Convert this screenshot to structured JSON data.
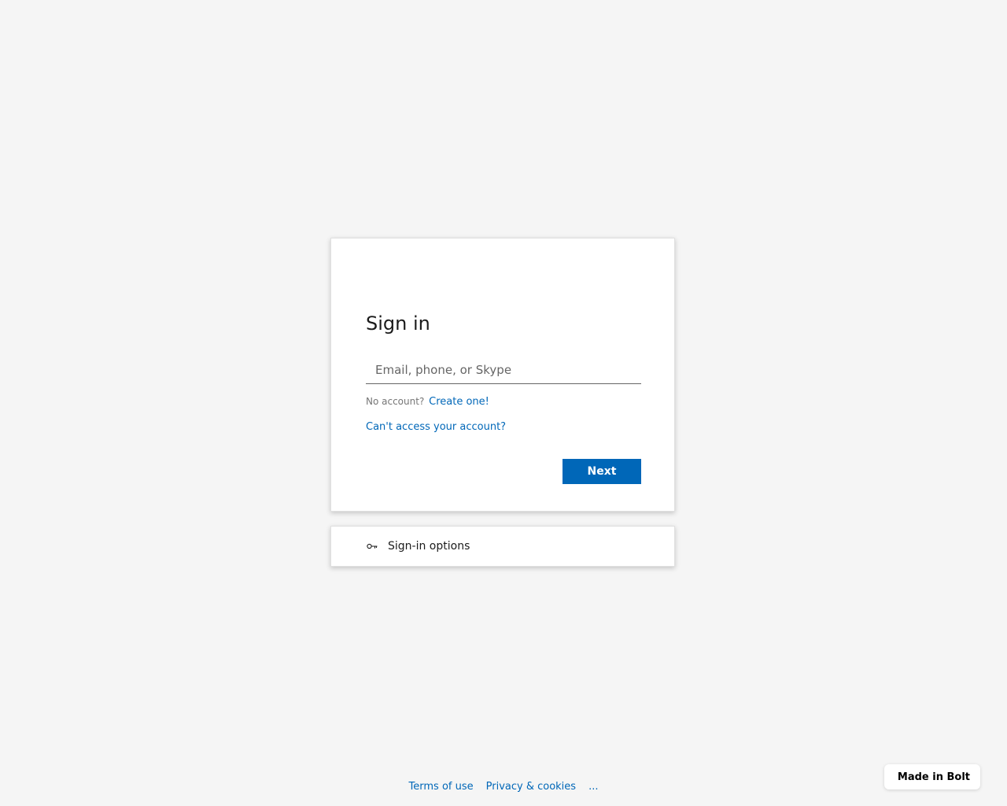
{
  "signin": {
    "title": "Sign in",
    "email_placeholder": "Email, phone, or Skype",
    "email_value": "",
    "no_account_text": "No account?",
    "create_link": "Create one!",
    "cant_access_link": "Can't access your account?",
    "next_button": "Next"
  },
  "options": {
    "icon": "key-icon",
    "label": "Sign-in options"
  },
  "footer": {
    "terms": "Terms of use",
    "privacy": "Privacy & cookies",
    "more": "..."
  },
  "badge": {
    "label": "Made in Bolt"
  },
  "colors": {
    "accent": "#0067b8",
    "background": "#f5f5f5"
  }
}
